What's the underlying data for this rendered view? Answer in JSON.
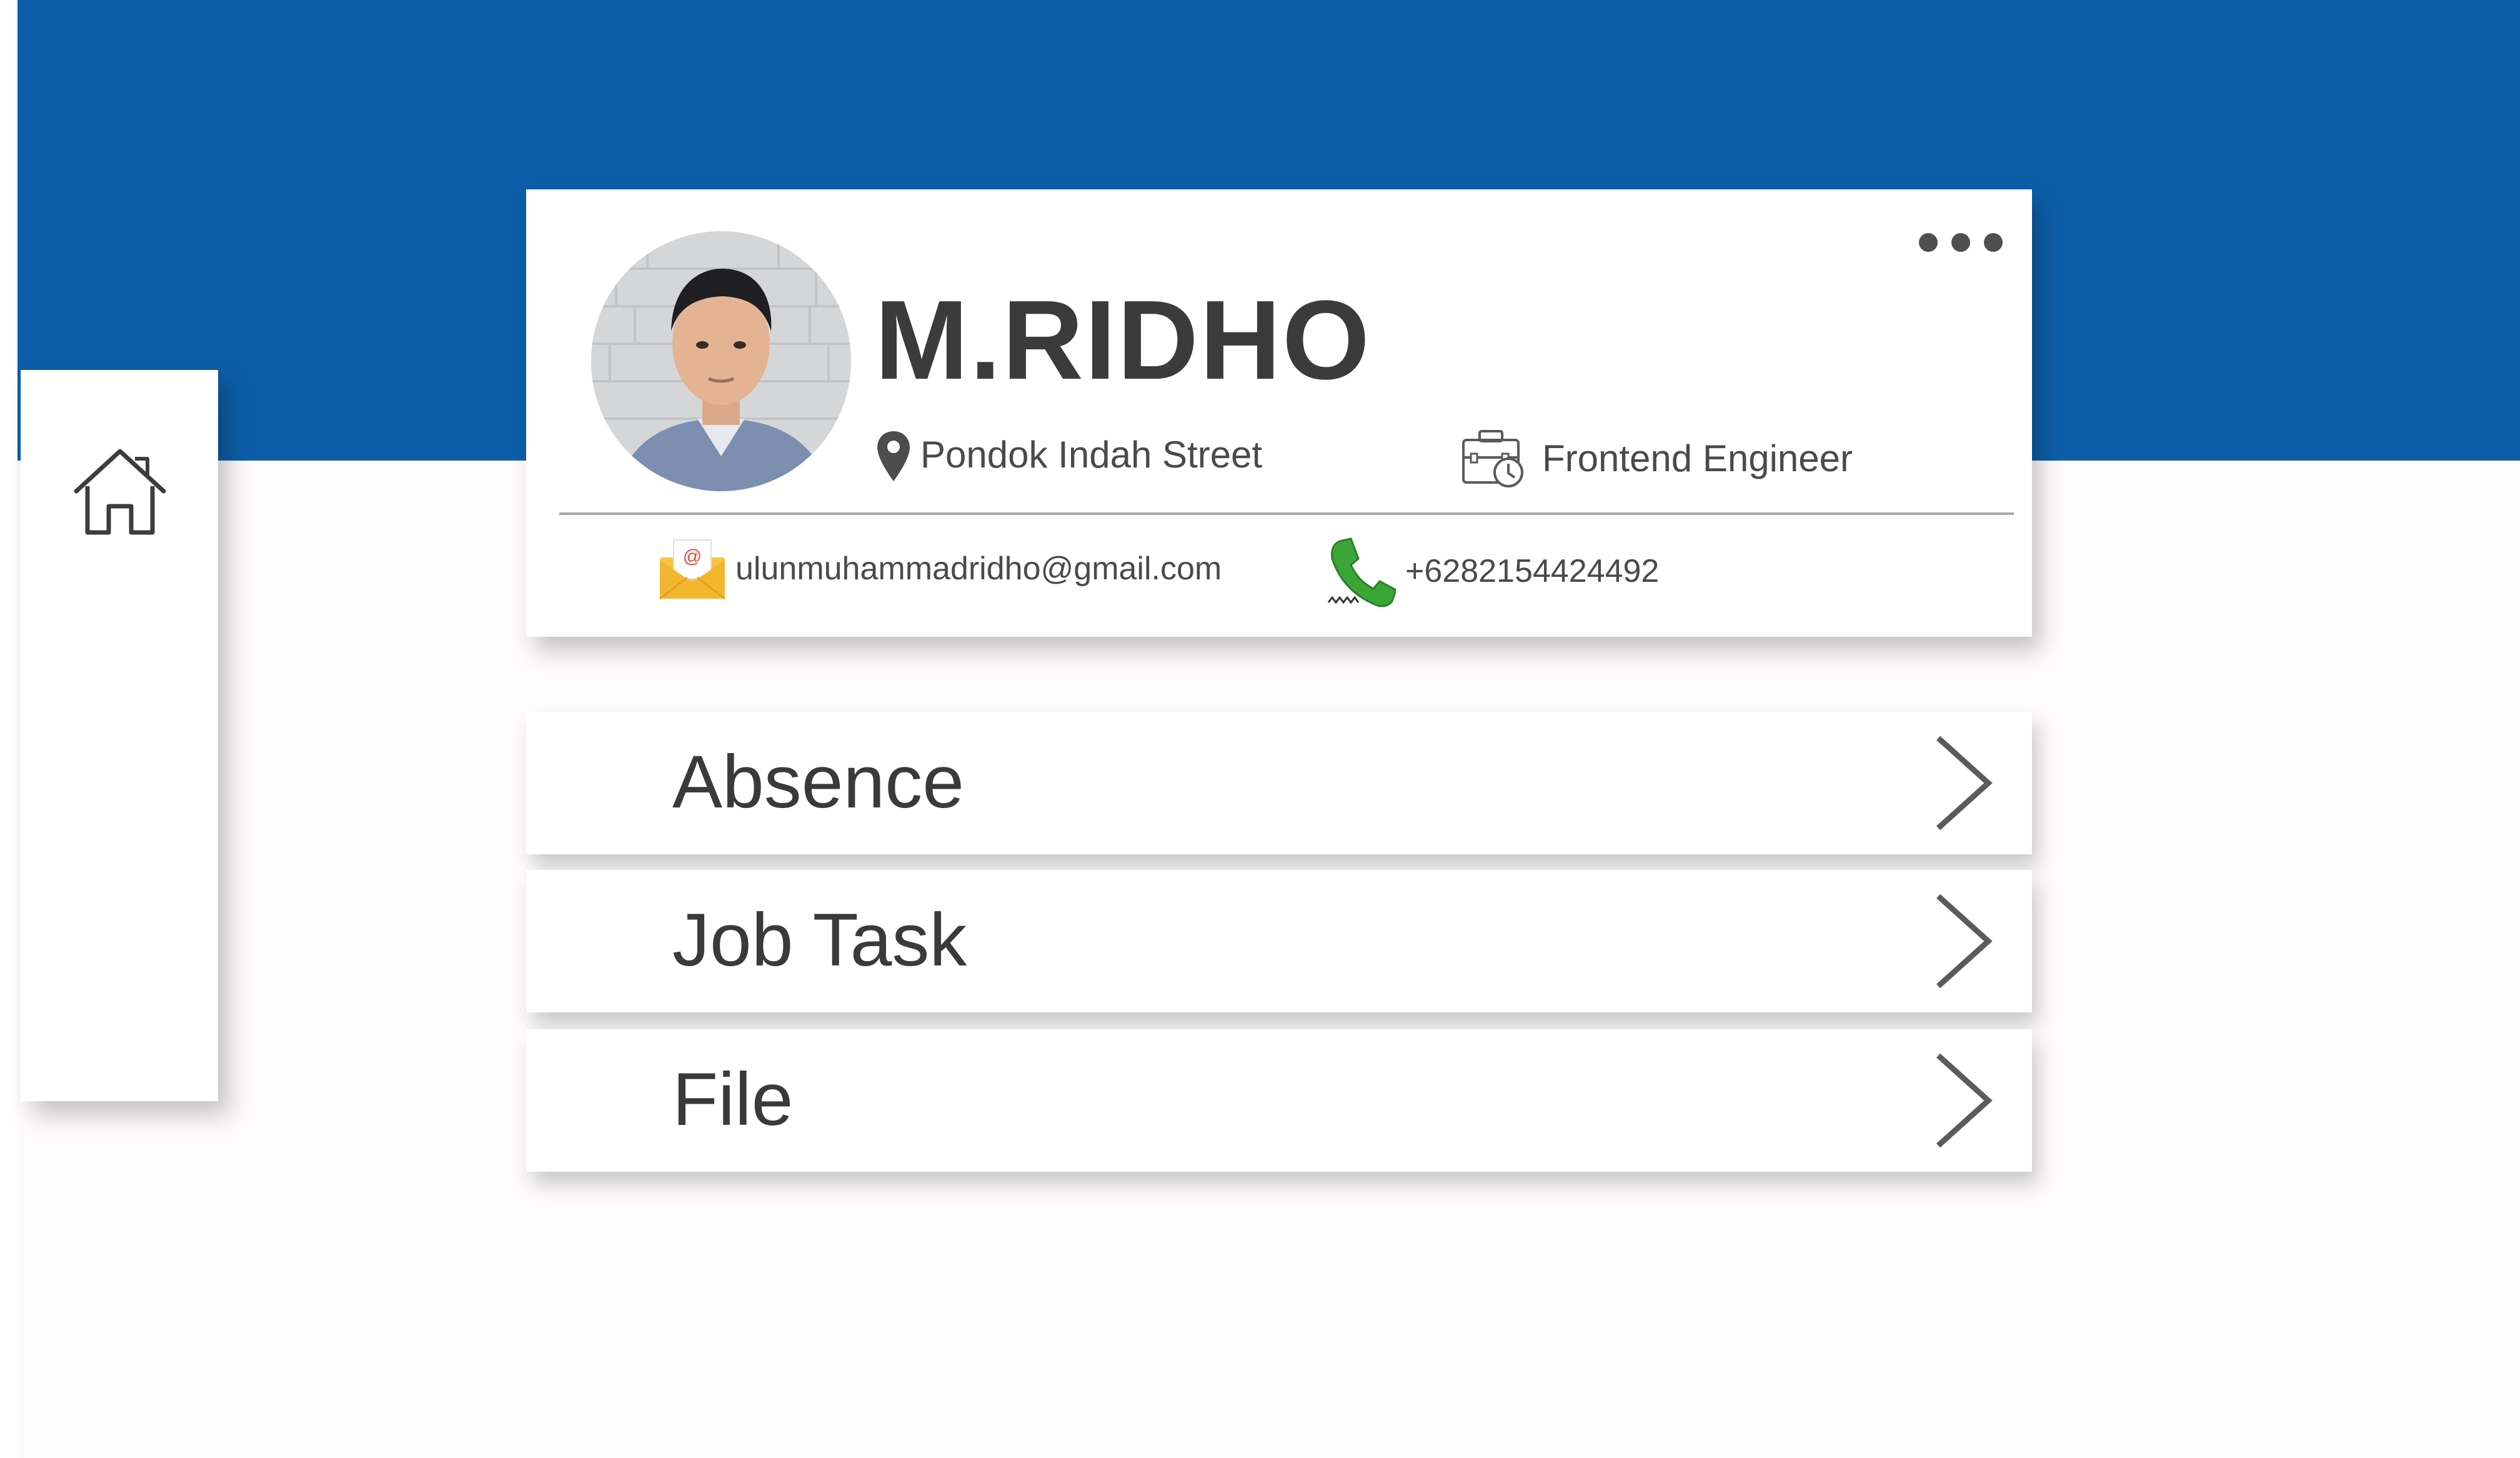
{
  "colors": {
    "header_blue": "#0c5ea8",
    "page_bg": "#fdfbfc",
    "card_bg": "#ffffff",
    "text_dark": "#3b3b3b",
    "phone_green": "#3aa637",
    "mail_yellow": "#f6c343"
  },
  "sidebar": {
    "items": [
      {
        "icon": "home-icon"
      }
    ]
  },
  "profile": {
    "name": "M.RIDHO",
    "location": "Pondok Indah Street",
    "job_title": "Frontend Engineer",
    "email": "ulunmuhammadridho@gmail.com",
    "phone": "+6282154424492",
    "avatar_icon": "avatar-photo",
    "more_icon": "more-dots-icon"
  },
  "menu": [
    {
      "label": "Absence",
      "icon": "chevron-right-icon"
    },
    {
      "label": "Job Task",
      "icon": "chevron-right-icon"
    },
    {
      "label": "File",
      "icon": "chevron-right-icon"
    }
  ]
}
